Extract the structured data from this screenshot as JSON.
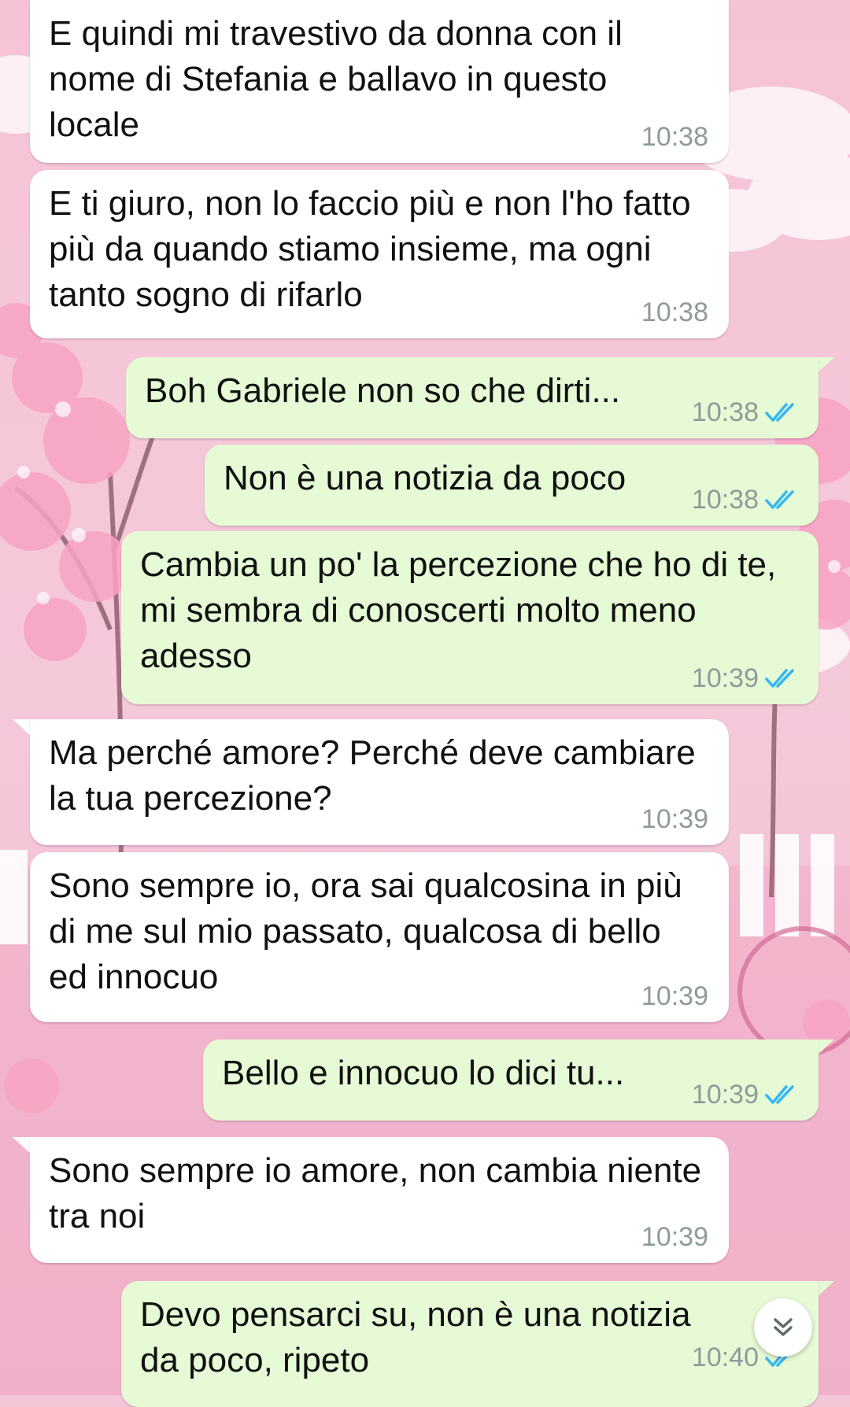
{
  "messages": [
    {
      "dir": "in",
      "text": "E quindi mi travestivo da donna con il nome di Stefania e ballavo in questo locale",
      "time": "10:38"
    },
    {
      "dir": "in",
      "text": "E ti giuro, non lo faccio più e non l'ho fatto più da quando stiamo insieme, ma ogni tanto sogno di rifarlo",
      "time": "10:38"
    },
    {
      "dir": "out",
      "text": "Boh Gabriele non so che dirti...",
      "time": "10:38",
      "status": "read"
    },
    {
      "dir": "out",
      "text": "Non è una notizia da poco",
      "time": "10:38",
      "status": "read"
    },
    {
      "dir": "out",
      "text": "Cambia un po' la percezione che ho di te, mi sembra di conoscerti molto meno adesso",
      "time": "10:39",
      "status": "read"
    },
    {
      "dir": "in",
      "text": "Ma perché amore? Perché deve cambiare la tua percezione?",
      "time": "10:39"
    },
    {
      "dir": "in",
      "text": "Sono sempre io, ora sai qualcosina in più di me sul mio passato, qualcosa di bello ed innocuo",
      "time": "10:39"
    },
    {
      "dir": "out",
      "text": "Bello e innocuo lo dici tu...",
      "time": "10:39",
      "status": "read"
    },
    {
      "dir": "in",
      "text": "Sono sempre io amore, non cambia niente tra noi",
      "time": "10:39"
    },
    {
      "dir": "out",
      "text": "Devo pensarci su, non è una notizia da poco, ripeto",
      "time": "10:40",
      "status": "read"
    }
  ],
  "icons": {
    "read_receipt": "double-check-icon",
    "scroll_down": "double-chevron-down-icon"
  },
  "colors": {
    "incoming_bubble": "#ffffff",
    "outgoing_bubble": "#e5fad5",
    "read_ticks": "#34b7f1",
    "timestamp": "#8f9a9a",
    "wallpaper": "#f3c6d8"
  }
}
